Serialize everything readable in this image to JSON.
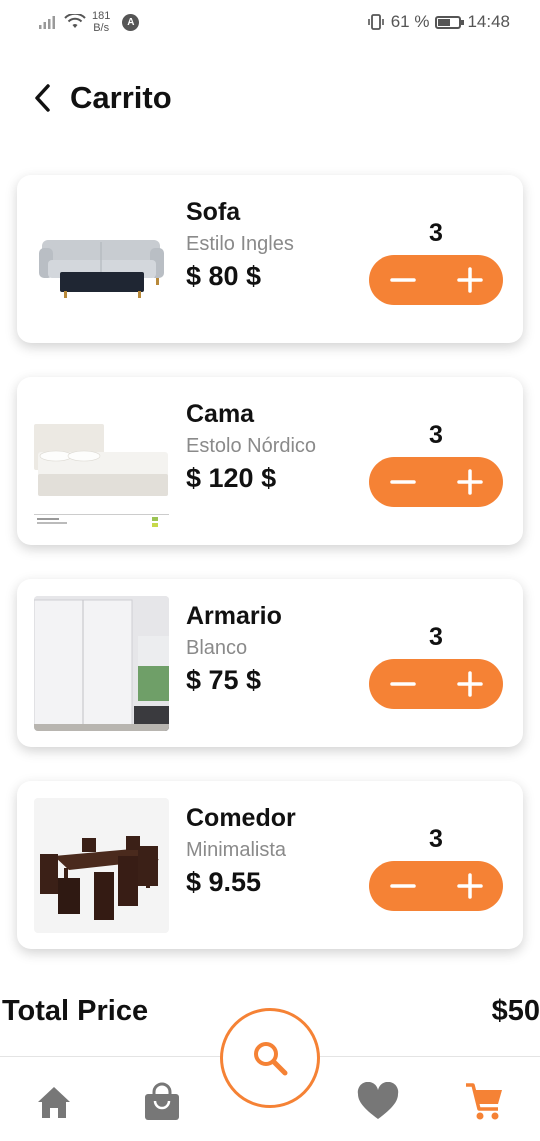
{
  "status_bar": {
    "net_speed_value": "181",
    "net_speed_unit": "B/s",
    "app_badge": "A",
    "battery_percent": "61 %",
    "battery_level": 0.61,
    "time": "14:48"
  },
  "header": {
    "title": "Carrito",
    "back_icon": "chevron-left-icon"
  },
  "cart": {
    "items": [
      {
        "name": "Sofa",
        "subtitle": "Estilo Ingles",
        "price": "$ 80 $",
        "quantity": "3"
      },
      {
        "name": "Cama",
        "subtitle": "Estolo Nórdico",
        "price": "$ 120 $",
        "quantity": "3"
      },
      {
        "name": "Armario",
        "subtitle": "Blanco",
        "price": "$ 75 $",
        "quantity": "3"
      },
      {
        "name": "Comedor",
        "subtitle": "Minimalista",
        "price": "$ 9.55",
        "quantity": "3"
      }
    ]
  },
  "total": {
    "label": "Total Price",
    "value": "$50"
  },
  "bottom_nav": {
    "items": [
      "home-icon",
      "shopping-bag-icon",
      "search-icon",
      "heart-icon",
      "cart-icon"
    ],
    "active": "cart-icon"
  },
  "colors": {
    "accent": "#f58235",
    "nav_inactive": "#777777"
  }
}
